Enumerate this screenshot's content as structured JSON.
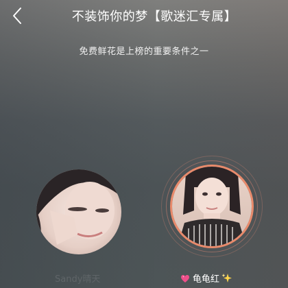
{
  "header": {
    "title": "不装饰你的梦【歌迷汇专属】"
  },
  "subtitle": "免费鲜花是上榜的重要条件之一",
  "contestants": [
    {
      "name": "Sandy晴天"
    },
    {
      "name": "龟龟红"
    }
  ],
  "colors": {
    "ring": "#e98a6b",
    "left_name": "#5f6568",
    "right_name": "#ffffff"
  },
  "icons": {
    "back": "chevron-left-icon",
    "heart": "sparkling-heart-icon",
    "sparkle": "sparkles-icon"
  }
}
